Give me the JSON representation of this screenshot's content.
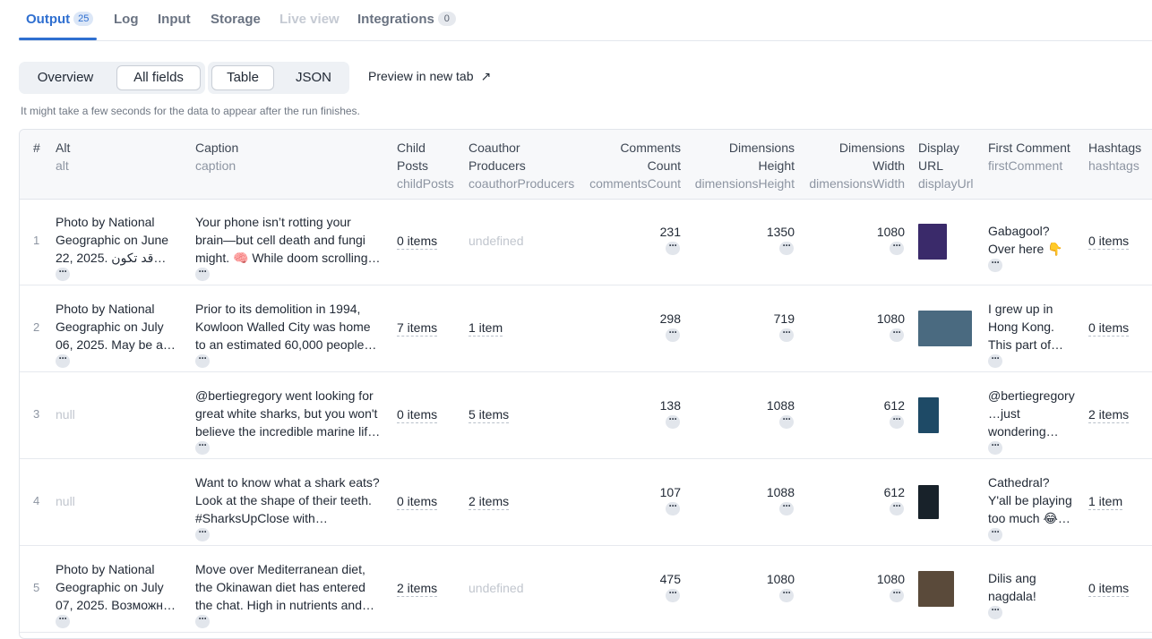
{
  "tabs": [
    {
      "label": "Output",
      "badge": "25"
    },
    {
      "label": "Log"
    },
    {
      "label": "Input"
    },
    {
      "label": "Storage"
    },
    {
      "label": "Live view"
    },
    {
      "label": "Integrations",
      "badge": "0"
    }
  ],
  "toolbar": {
    "overview": "Overview",
    "all_fields": "All fields",
    "table": "Table",
    "json": "JSON",
    "preview": "Preview in new tab",
    "preview_arrow": "↗",
    "hint": "It might take a few seconds for the data to appear after the run finishes."
  },
  "table": {
    "more_label": "···",
    "columns": [
      {
        "label": "#",
        "key": ""
      },
      {
        "label": "Alt",
        "key": "alt"
      },
      {
        "label": "Caption",
        "key": "caption"
      },
      {
        "label1": "Child",
        "label2": "Posts",
        "key": "childPosts"
      },
      {
        "label1": "Coauthor",
        "label2": "Producers",
        "key": "coauthorProducers"
      },
      {
        "label1": "Comments",
        "label2": "Count",
        "key": "commentsCount"
      },
      {
        "label1": "Dimensions",
        "label2": "Height",
        "key": "dimensionsHeight"
      },
      {
        "label1": "Dimensions",
        "label2": "Width",
        "key": "dimensionsWidth"
      },
      {
        "label1": "Display",
        "label2": "URL",
        "key": "displayUrl"
      },
      {
        "label": "First Comment",
        "key": "firstComment"
      },
      {
        "label": "Hashtags",
        "key": "hashtags"
      }
    ],
    "rows": [
      {
        "index": "1",
        "alt": [
          "Photo by National",
          "Geographic on June",
          "22, 2025. قد تكون…"
        ],
        "caption": [
          "Your phone isn’t rotting your",
          "brain—but cell death and fungi",
          "might. 🧠 While doom scrolling…"
        ],
        "childPosts": "0 items",
        "coauthor": "undefined",
        "comments": "231",
        "height": "1350",
        "width": "1080",
        "thumb_color": "#3a2a6a",
        "firstComment": [
          "Gabagool?",
          "Over here 👇"
        ],
        "hashtags": "0 items"
      },
      {
        "index": "2",
        "alt": [
          "Photo by National",
          "Geographic on July",
          "06, 2025. May be a…"
        ],
        "caption": [
          "Prior to its demolition in 1994,",
          "Kowloon Walled City was home",
          "to an estimated 60,000 people…"
        ],
        "childPosts": "7 items",
        "coauthor": "1 item",
        "comments": "298",
        "height": "719",
        "width": "1080",
        "thumb_color": "#4a6a80",
        "firstComment": [
          "I grew up in",
          "Hong Kong.",
          "This part of…"
        ],
        "hashtags": "0 items"
      },
      {
        "index": "3",
        "alt": [
          "null"
        ],
        "caption": [
          "@bertiegregory went looking for",
          "great white sharks, but you won't",
          "believe the incredible marine lif…"
        ],
        "childPosts": "0 items",
        "coauthor": "5 items",
        "comments": "138",
        "height": "1088",
        "width": "612",
        "thumb_color": "#1e4a66",
        "firstComment": [
          "@bertiegregory",
          "…just",
          "wondering…"
        ],
        "hashtags": "2 items"
      },
      {
        "index": "4",
        "alt": [
          "null"
        ],
        "caption": [
          "Want to know what a shark eats?",
          "Look at the shape of their teeth.",
          "#SharksUpClose with…"
        ],
        "childPosts": "0 items",
        "coauthor": "2 items",
        "comments": "107",
        "height": "1088",
        "width": "612",
        "thumb_color": "#18222a",
        "firstComment": [
          "Cathedral?",
          "Y'all be playing",
          "too much 😂…"
        ],
        "hashtags": "1 item"
      },
      {
        "index": "5",
        "alt": [
          "Photo by National",
          "Geographic on July",
          "07, 2025. Возможн…"
        ],
        "caption": [
          "Move over Mediterranean diet,",
          "the Okinawan diet has entered",
          "the chat. High in nutrients and…"
        ],
        "childPosts": "2 items",
        "coauthor": "undefined",
        "comments": "475",
        "height": "1080",
        "width": "1080",
        "thumb_color": "#5a4a3a",
        "firstComment": [
          "Dilis ang",
          "nagdala!"
        ],
        "hashtags": "0 items"
      }
    ]
  }
}
